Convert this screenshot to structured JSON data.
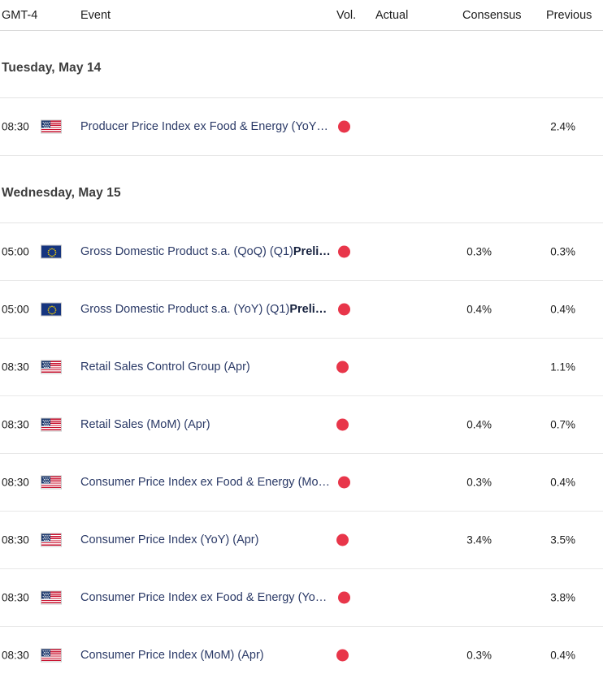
{
  "table": {
    "columns": {
      "timezone": "GMT-4",
      "event": "Event",
      "volatility": "Vol.",
      "actual": "Actual",
      "consensus": "Consensus",
      "previous": "Previous"
    },
    "volatility_color": "#e8364a",
    "link_color": "#2b3a67",
    "groups": [
      {
        "date_label": "Tuesday, May 14",
        "rows": [
          {
            "time": "08:30",
            "flag": "us-flag-icon",
            "country": "United States",
            "event": "Producer Price Index ex Food & Energy (YoY…",
            "event_bold": "",
            "truncated": true,
            "volatility": "high",
            "actual": "",
            "consensus": "",
            "previous": "2.4%"
          }
        ]
      },
      {
        "date_label": "Wednesday, May 15",
        "rows": [
          {
            "time": "05:00",
            "flag": "eu-flag-icon",
            "country": "European Union",
            "event": "Gross Domestic Product s.a. (QoQ) (Q1)",
            "event_bold": "Preli…",
            "truncated": true,
            "volatility": "high",
            "actual": "",
            "consensus": "0.3%",
            "previous": "0.3%"
          },
          {
            "time": "05:00",
            "flag": "eu-flag-icon",
            "country": "European Union",
            "event": "Gross Domestic Product s.a. (YoY) (Q1)",
            "event_bold": "Preli…",
            "truncated": true,
            "volatility": "high",
            "actual": "",
            "consensus": "0.4%",
            "previous": "0.4%"
          },
          {
            "time": "08:30",
            "flag": "us-flag-icon",
            "country": "United States",
            "event": "Retail Sales Control Group (Apr)",
            "event_bold": "",
            "truncated": false,
            "volatility": "high",
            "actual": "",
            "consensus": "",
            "previous": "1.1%"
          },
          {
            "time": "08:30",
            "flag": "us-flag-icon",
            "country": "United States",
            "event": "Retail Sales (MoM) (Apr)",
            "event_bold": "",
            "truncated": false,
            "volatility": "high",
            "actual": "",
            "consensus": "0.4%",
            "previous": "0.7%"
          },
          {
            "time": "08:30",
            "flag": "us-flag-icon",
            "country": "United States",
            "event": "Consumer Price Index ex Food & Energy (Mo…",
            "event_bold": "",
            "truncated": true,
            "volatility": "high",
            "actual": "",
            "consensus": "0.3%",
            "previous": "0.4%"
          },
          {
            "time": "08:30",
            "flag": "us-flag-icon",
            "country": "United States",
            "event": "Consumer Price Index (YoY) (Apr)",
            "event_bold": "",
            "truncated": false,
            "volatility": "high",
            "actual": "",
            "consensus": "3.4%",
            "previous": "3.5%"
          },
          {
            "time": "08:30",
            "flag": "us-flag-icon",
            "country": "United States",
            "event": "Consumer Price Index ex Food & Energy (Yo…",
            "event_bold": "",
            "truncated": true,
            "volatility": "high",
            "actual": "",
            "consensus": "",
            "previous": "3.8%"
          },
          {
            "time": "08:30",
            "flag": "us-flag-icon",
            "country": "United States",
            "event": "Consumer Price Index (MoM) (Apr)",
            "event_bold": "",
            "truncated": false,
            "volatility": "high",
            "actual": "",
            "consensus": "0.3%",
            "previous": "0.4%"
          }
        ]
      }
    ]
  }
}
